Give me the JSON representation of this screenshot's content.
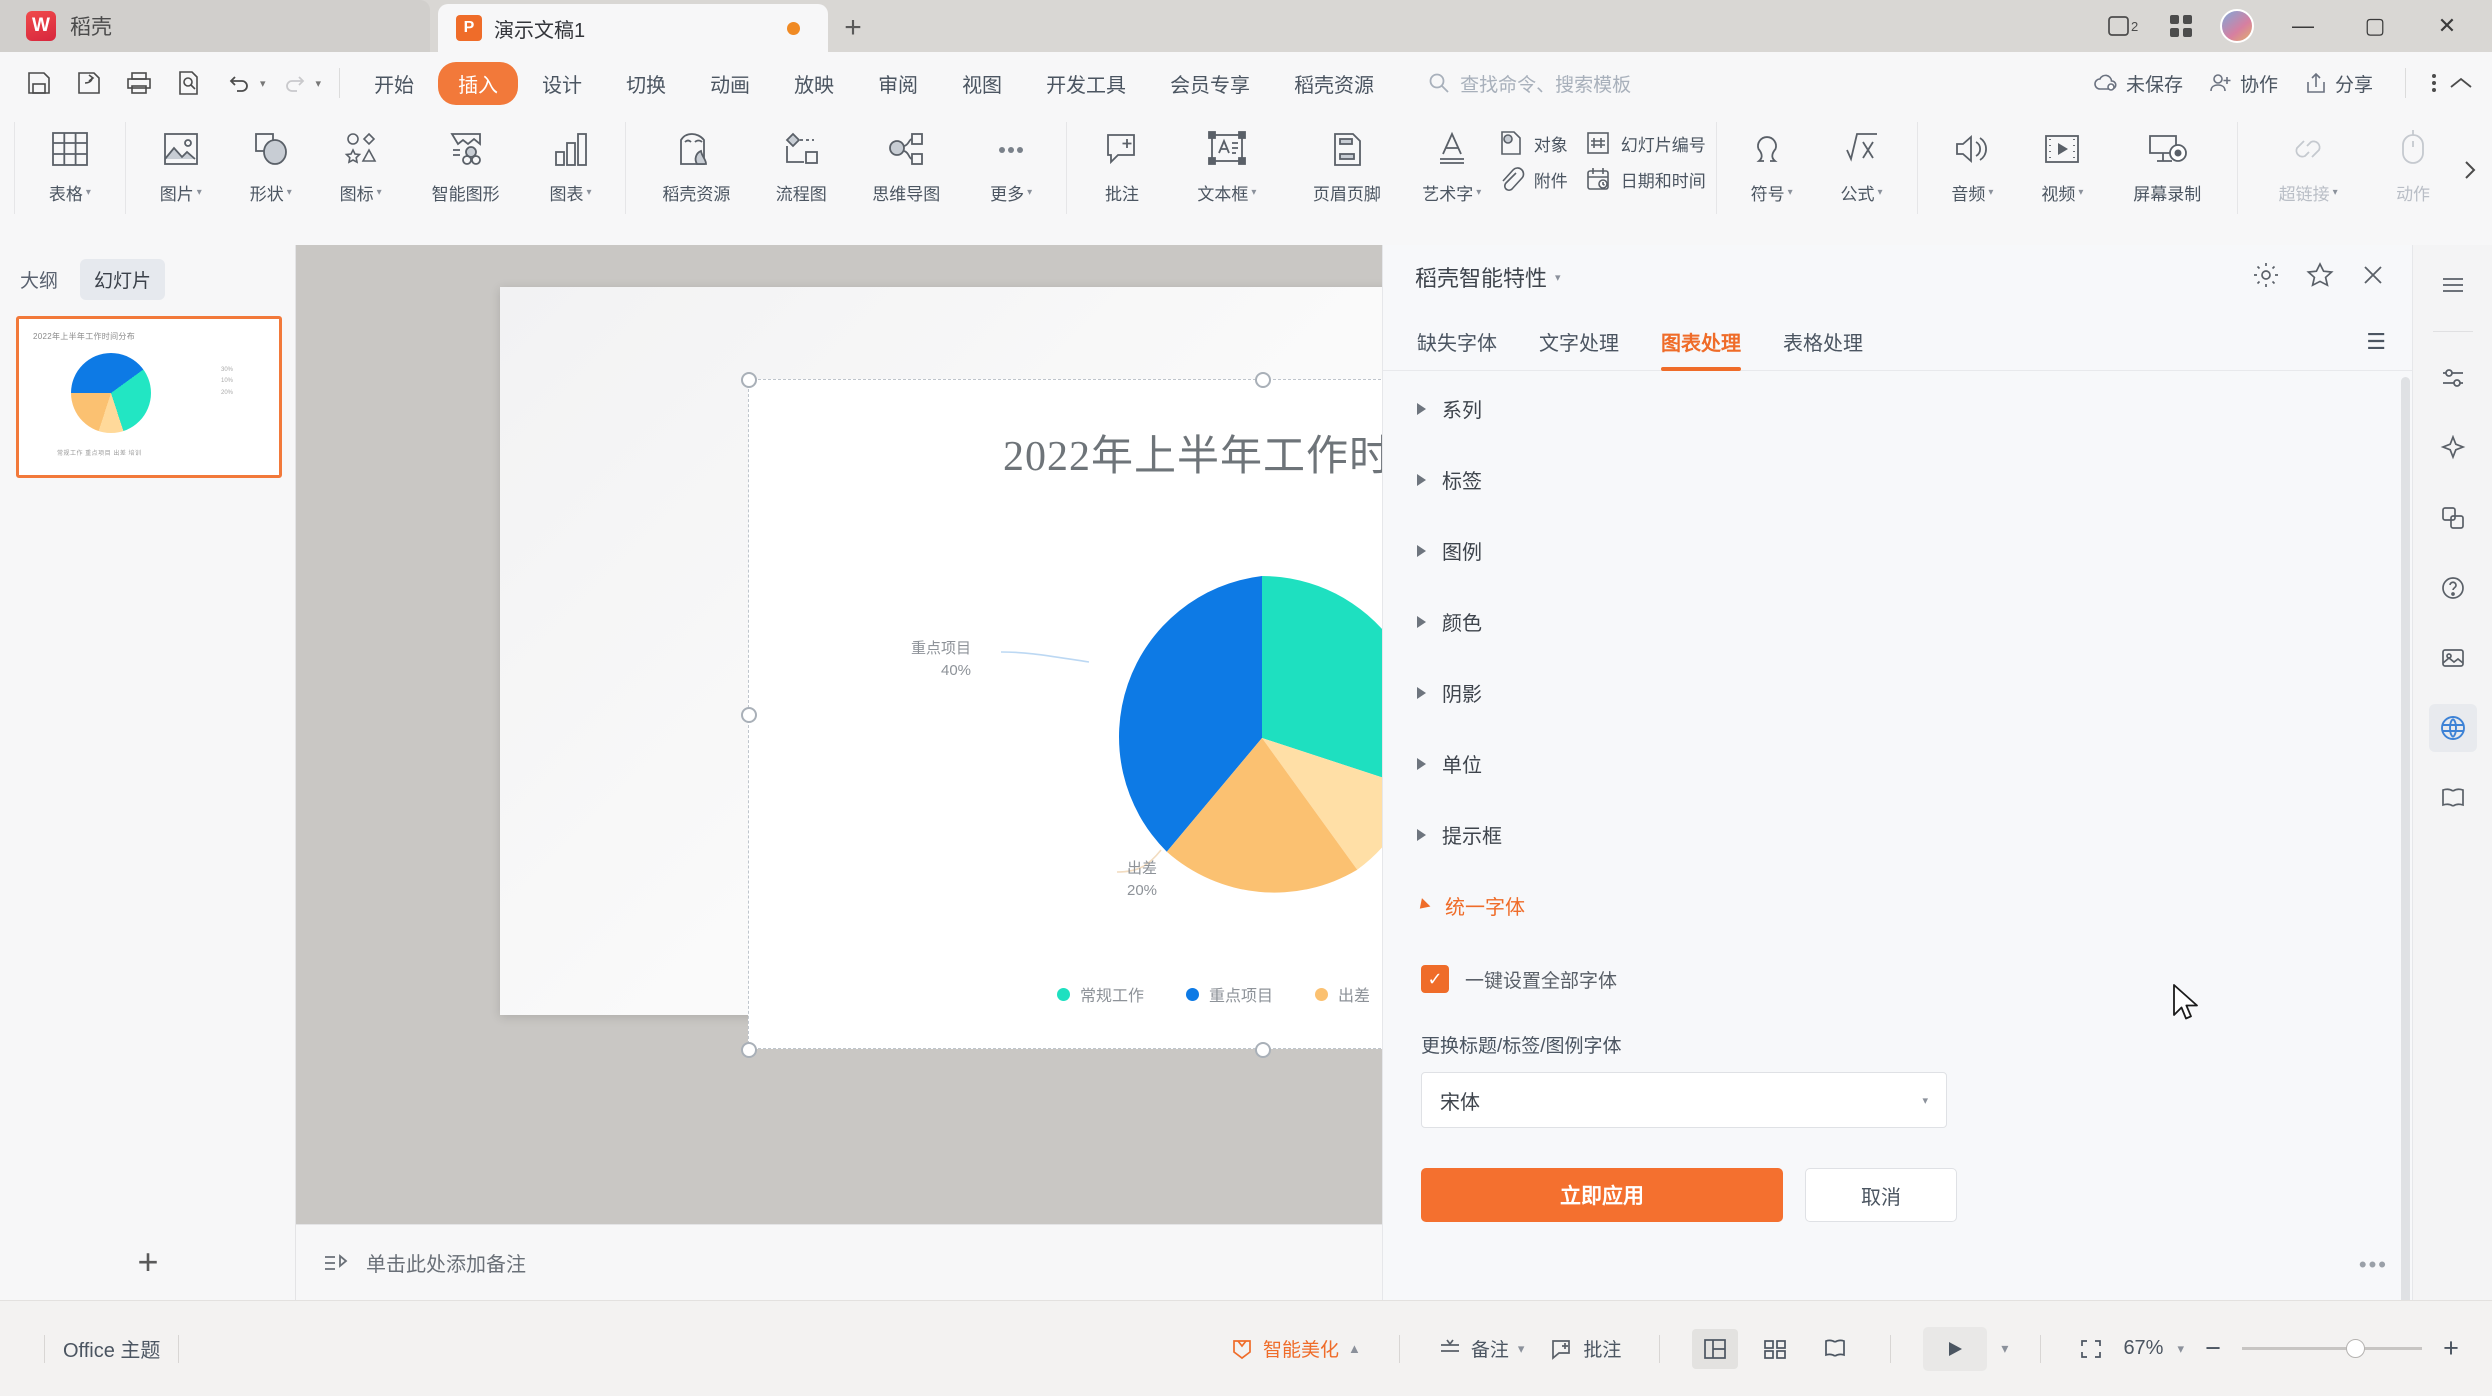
{
  "titlebar": {
    "home_tab": "稻壳",
    "doc_tab": "演示文稿1",
    "new_tab": "+",
    "minimize": "—",
    "maximize": "▢",
    "close": "✕"
  },
  "quick_access": {
    "icons": [
      "save-icon",
      "save-as-icon",
      "print-icon",
      "print-preview-icon",
      "undo-icon",
      "redo-icon",
      "customize-icon"
    ]
  },
  "menu": {
    "tabs": [
      "开始",
      "插入",
      "设计",
      "切换",
      "动画",
      "放映",
      "审阅",
      "视图",
      "开发工具",
      "会员专享",
      "稻壳资源"
    ],
    "active": "插入",
    "search_placeholder": "查找命令、搜索模板"
  },
  "title_right": {
    "cloud_status": "未保存",
    "collaborate": "协作",
    "share": "分享"
  },
  "ribbon": {
    "groups": [
      {
        "items": [
          {
            "label": "表格",
            "icon": "table-icon",
            "caret": true
          }
        ]
      },
      {
        "items": [
          {
            "label": "图片",
            "icon": "picture-icon",
            "caret": true
          },
          {
            "label": "形状",
            "icon": "shapes-icon",
            "caret": true
          },
          {
            "label": "图标",
            "icon": "icons-icon",
            "caret": true
          },
          {
            "label": "智能图形",
            "icon": "smartart-icon",
            "caret": false
          },
          {
            "label": "图表",
            "icon": "chart-icon",
            "caret": true
          }
        ]
      },
      {
        "items": [
          {
            "label": "稻壳资源",
            "icon": "resources-icon",
            "caret": false
          },
          {
            "label": "流程图",
            "icon": "flowchart-icon",
            "caret": false
          },
          {
            "label": "思维导图",
            "icon": "mindmap-icon",
            "caret": false
          },
          {
            "label": "更多",
            "icon": "more-icon",
            "caret": true
          }
        ]
      },
      {
        "items": [
          {
            "label": "批注",
            "icon": "comment-icon",
            "caret": false
          },
          {
            "label": "文本框",
            "icon": "textbox-icon",
            "caret": true
          },
          {
            "label": "页眉页脚",
            "icon": "headerfooter-icon",
            "caret": false
          },
          {
            "label": "艺术字",
            "icon": "wordart-icon",
            "caret": true
          }
        ]
      },
      {
        "stacks": [
          {
            "top": {
              "label": "对象",
              "icon": "object-icon"
            },
            "bottom": {
              "label": "附件",
              "icon": "attachment-icon"
            }
          },
          {
            "top": {
              "label": "幻灯片编号",
              "icon": "slidenumber-icon"
            },
            "bottom": {
              "label": "日期和时间",
              "icon": "datetime-icon"
            }
          }
        ]
      },
      {
        "items": [
          {
            "label": "符号",
            "icon": "symbol-icon",
            "caret": true
          },
          {
            "label": "公式",
            "icon": "formula-icon",
            "caret": true
          }
        ]
      },
      {
        "items": [
          {
            "label": "音频",
            "icon": "audio-icon",
            "caret": true
          },
          {
            "label": "视频",
            "icon": "video-icon",
            "caret": true
          },
          {
            "label": "屏幕录制",
            "icon": "screenrecord-icon",
            "caret": false
          }
        ]
      },
      {
        "items": [
          {
            "label": "超链接",
            "icon": "hyperlink-icon",
            "caret": true,
            "dim": true
          },
          {
            "label": "动作",
            "icon": "action-icon",
            "caret": false,
            "dim": true
          }
        ]
      }
    ]
  },
  "left_panel": {
    "tabs": [
      "大纲",
      "幻灯片"
    ],
    "active_tab": "幻灯片",
    "thumb_title": "2022年上半年工作时间分布",
    "thumb_legend": "常规工作 重点项目 出差 培训",
    "add_slide": "+"
  },
  "chart_data": {
    "type": "pie",
    "title": "2022年上半年工作时间分布",
    "categories": [
      "常规工作",
      "重点项目",
      "出差",
      "培训"
    ],
    "values": [
      30,
      40,
      20,
      10
    ],
    "value_suffix": "%",
    "colors": [
      "#1ee0c0",
      "#0d7ae5",
      "#fbc171",
      "#ffdfa6"
    ],
    "legend_position": "bottom",
    "labels": [
      {
        "name": "常规工作",
        "value": "30%"
      },
      {
        "name": "重点项目",
        "value": "40%"
      },
      {
        "name": "出差",
        "value": "20%"
      },
      {
        "name": "培训",
        "value": "10%"
      }
    ]
  },
  "notes": {
    "placeholder": "单击此处添加备注"
  },
  "right_panel": {
    "title": "稻壳智能特性",
    "header_icons": [
      "gear-icon",
      "pin-icon",
      "close-icon"
    ],
    "tabs": [
      "缺失字体",
      "文字处理",
      "图表处理",
      "表格处理"
    ],
    "active_tab": "图表处理",
    "sections": [
      {
        "label": "系列",
        "open": false
      },
      {
        "label": "标签",
        "open": false
      },
      {
        "label": "图例",
        "open": false
      },
      {
        "label": "颜色",
        "open": false
      },
      {
        "label": "阴影",
        "open": false
      },
      {
        "label": "单位",
        "open": false
      },
      {
        "label": "提示框",
        "open": false
      },
      {
        "label": "统一字体",
        "open": true
      }
    ],
    "checkbox_label": "一键设置全部字体",
    "checkbox_checked": true,
    "field_label": "更换标题/标签/图例字体",
    "font_value": "宋体",
    "apply_button": "立即应用",
    "cancel_button": "取消",
    "accent_color": "#ef6c29"
  },
  "status_bar": {
    "theme": "Office 主题",
    "beautify": "智能美化",
    "notes": "备注",
    "comment": "批注",
    "zoom": "67%",
    "zoom_out": "−",
    "zoom_in": "+"
  }
}
